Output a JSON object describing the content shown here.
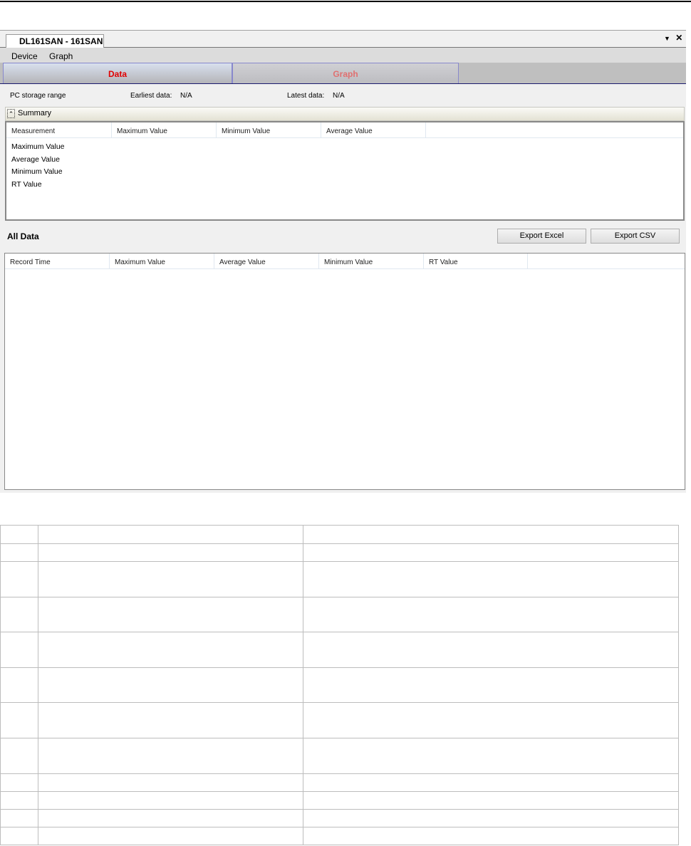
{
  "window": {
    "doc_tab": "DL161SAN - 161SAN",
    "dropdown_icon": "triangle-down-icon",
    "close_icon": "close-icon"
  },
  "menu": [
    "Device",
    "Graph"
  ],
  "tabs": [
    {
      "label": "Data",
      "active": true,
      "color": "#e00000"
    },
    {
      "label": "Graph",
      "active": false,
      "color": "#e07070"
    }
  ],
  "storage": {
    "label": "PC storage range",
    "earliest_label": "Earliest data:",
    "earliest_value": "N/A",
    "latest_label": "Latest data:",
    "latest_value": "N/A"
  },
  "summary": {
    "title": "Summary",
    "columns": [
      "Measurement",
      "Maximum Value",
      "Minimum Value",
      "Average Value"
    ],
    "rows": [
      "Maximum Value",
      "Average Value",
      "Minimum Value",
      "RT Value"
    ]
  },
  "all_data": {
    "title": "All Data",
    "export_excel": "Export Excel",
    "export_csv": "Export CSV",
    "columns": [
      "Record Time",
      "Maximum Value",
      "Average Value",
      "Minimum Value",
      "RT Value"
    ]
  }
}
